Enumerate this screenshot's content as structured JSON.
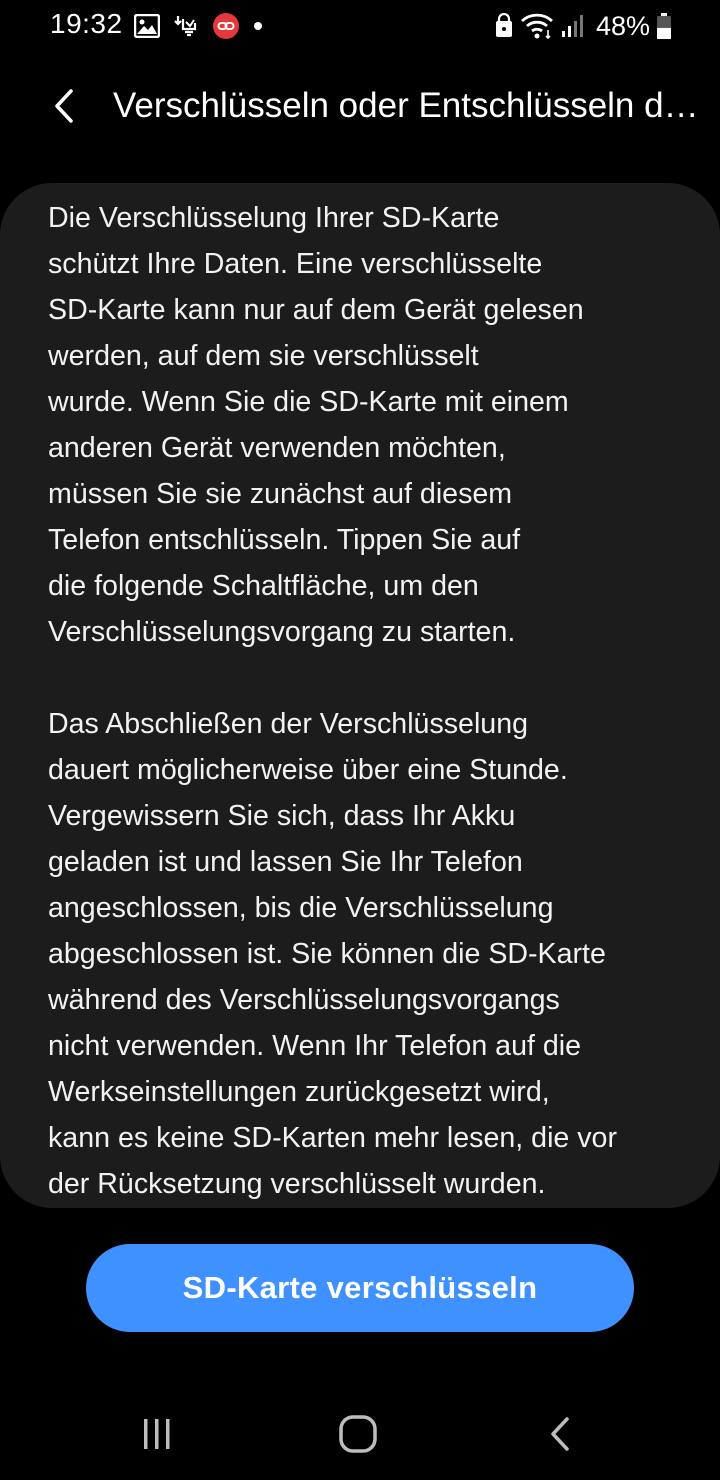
{
  "status_bar": {
    "time": "19:32",
    "battery_percent": "48%",
    "left_icons": [
      "image-icon",
      "download-alert-icon",
      "link-badge-icon",
      "dot-icon"
    ],
    "right_icons": [
      "lock-icon",
      "wifi-icon",
      "signal-icon",
      "battery-icon"
    ],
    "battery_level": 0.48
  },
  "app_bar": {
    "title": "Verschlüsseln oder Entschlüsseln der SD-Karte",
    "back_icon": "chevron-left-icon"
  },
  "content": {
    "paragraph_1": "Die Verschlüsselung Ihrer SD-Karte\nschützt Ihre Daten. Eine verschlüsselte\nSD-Karte kann nur auf dem Gerät gelesen\nwerden, auf dem sie verschlüsselt\nwurde. Wenn Sie die SD-Karte mit einem\nanderen Gerät verwenden möchten,\nmüssen Sie sie zunächst auf diesem\nTelefon entschlüsseln. Tippen Sie auf\ndie folgende Schaltfläche, um den\nVerschlüsselungsvorgang zu starten.",
    "paragraph_2": "Das Abschließen der Verschlüsselung\ndauert möglicherweise über eine Stunde.\nVergewissern Sie sich, dass Ihr Akku\ngeladen ist und lassen Sie Ihr Telefon\nangeschlossen, bis die Verschlüsselung\nabgeschlossen ist. Sie können die SD-Karte\nwährend des Verschlüsselungsvorgangs\nnicht verwenden. Wenn Ihr Telefon auf die\nWerkseinstellungen zurückgesetzt wird,\nkann es keine SD-Karten mehr lesen, die vor\nder Rücksetzung verschlüsselt wurden."
  },
  "action": {
    "button_label": "SD-Karte verschlüsseln"
  },
  "navigation_bar": {
    "icons": [
      "recent-apps-icon",
      "home-icon",
      "back-icon"
    ]
  },
  "colors": {
    "background": "#000000",
    "card": "#1c1c1c",
    "accent": "#3e91ff",
    "notification_badge": "#e5383b"
  }
}
